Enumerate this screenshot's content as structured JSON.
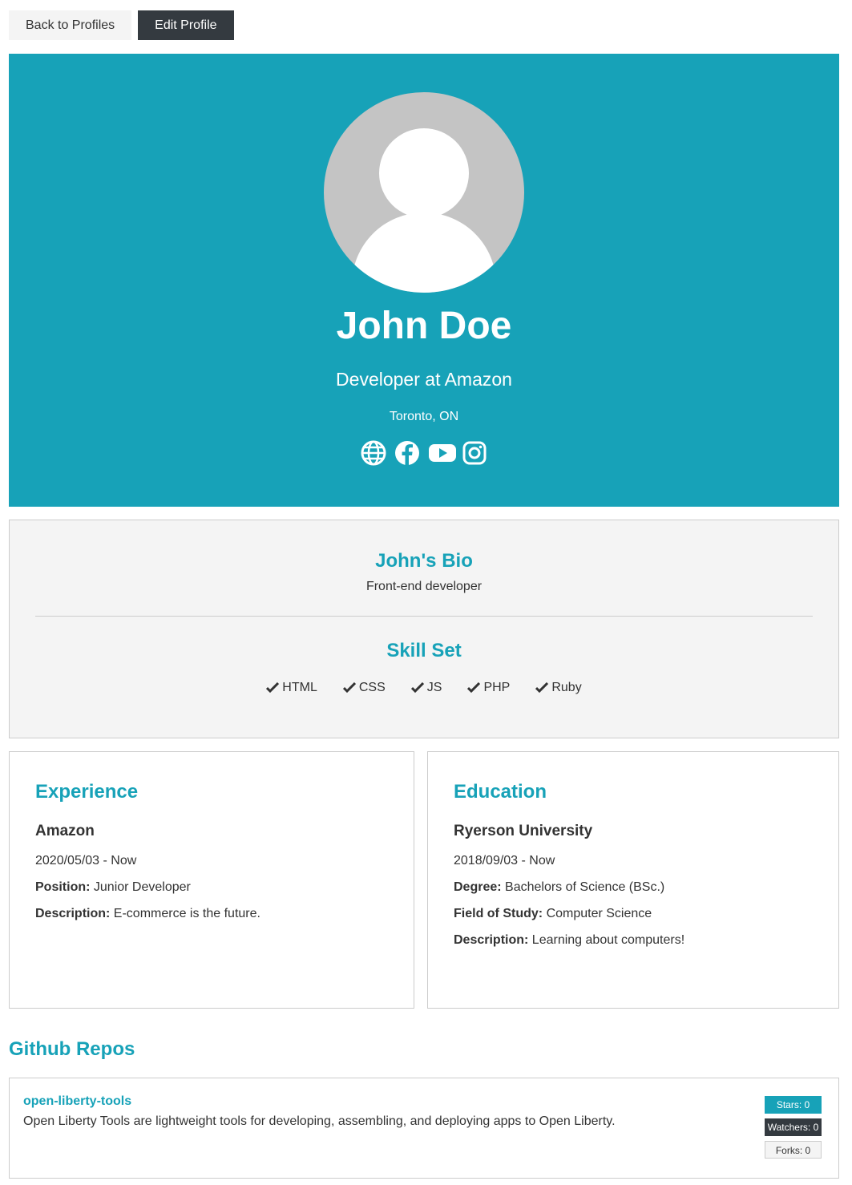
{
  "nav": {
    "back_label": "Back to Profiles",
    "edit_label": "Edit Profile"
  },
  "profile": {
    "name": "John Doe",
    "title": "Developer at Amazon",
    "location": "Toronto, ON",
    "socials": [
      "globe-icon",
      "facebook-icon",
      "youtube-icon",
      "instagram-icon"
    ]
  },
  "bio": {
    "title": "John's Bio",
    "text": "Front-end developer",
    "skills_title": "Skill Set",
    "skills": [
      "HTML",
      "CSS",
      "JS",
      "PHP",
      "Ruby"
    ]
  },
  "experience": {
    "heading": "Experience",
    "company": "Amazon",
    "dates": "2020/05/03 - Now",
    "position_label": "Position:",
    "position": "Junior Developer",
    "description_label": "Description:",
    "description": "E-commerce is the future."
  },
  "education": {
    "heading": "Education",
    "school": "Ryerson University",
    "dates": "2018/09/03 - Now",
    "degree_label": "Degree:",
    "degree": "Bachelors of Science (BSc.)",
    "field_label": "Field of Study:",
    "field": "Computer Science",
    "description_label": "Description:",
    "description": "Learning about computers!"
  },
  "repos": {
    "heading": "Github Repos",
    "items": [
      {
        "name": "open-liberty-tools",
        "description": "Open Liberty Tools are lightweight tools for developing, assembling, and deploying apps to Open Liberty.",
        "stars": "Stars: 0",
        "watchers": "Watchers: 0",
        "forks": "Forks: 0"
      }
    ]
  },
  "colors": {
    "accent": "#17a2b8",
    "dark": "#343a40",
    "light": "#f4f4f4"
  }
}
